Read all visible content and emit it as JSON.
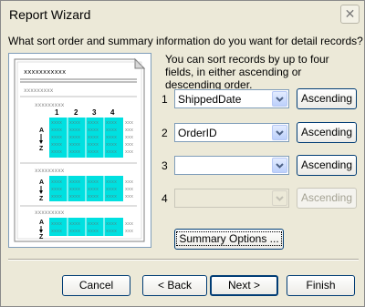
{
  "window": {
    "title": "Report Wizard"
  },
  "prompt": "What sort order and summary information do you want for detail records?",
  "description": "You can sort records by up to four fields, in either ascending or descending order.",
  "preview": {
    "placeholder_long": "xxxxxxxxxxx",
    "placeholder_short": "xxxxxxxxx",
    "sort_numbers": [
      "1",
      "2",
      "3",
      "4"
    ],
    "sort_letters": [
      "A",
      "Z"
    ]
  },
  "sort_rows": [
    {
      "number": "1",
      "field": "ShippedDate",
      "order": "Ascending",
      "enabled": true
    },
    {
      "number": "2",
      "field": "OrderID",
      "order": "Ascending",
      "enabled": true
    },
    {
      "number": "3",
      "field": "",
      "order": "Ascending",
      "enabled": true
    },
    {
      "number": "4",
      "field": "",
      "order": "Ascending",
      "enabled": false
    }
  ],
  "summary_options_label": "Summary Options ...",
  "buttons": {
    "cancel": "Cancel",
    "back": "< Back",
    "next": "Next >",
    "finish": "Finish"
  },
  "colors": {
    "highlight": "#00E0E0",
    "accent_border": "#003C74"
  }
}
